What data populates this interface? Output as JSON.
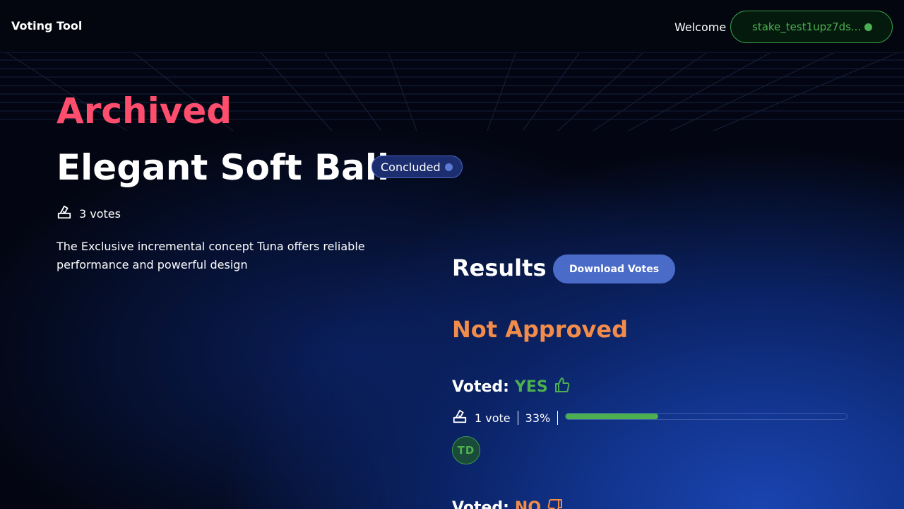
{
  "header": {
    "brand": "Voting Tool",
    "welcome": "Welcome",
    "wallet_address": "stake_test1upz7ds...",
    "wallet_status_color": "#4caf50"
  },
  "proposal": {
    "status_heading": "Archived",
    "title": "Elegant Soft Ball",
    "badge": "Concluded",
    "vote_count": "3 votes",
    "description": "The Exclusive incremental concept Tuna offers reliable performance and powerful design"
  },
  "results": {
    "title": "Results",
    "download_label": "Download Votes",
    "outcome": "Not Approved",
    "yes": {
      "voted_label": "Voted:",
      "choice": "YES",
      "votes": "1 vote",
      "percent_label": "33%",
      "fraction": 0.33,
      "voters": [
        "TD"
      ]
    },
    "no": {
      "voted_label": "Voted:",
      "choice": "NO"
    }
  },
  "colors": {
    "archived": "#ff4d6d",
    "outcome": "#f28c4a",
    "yes": "#4caf50",
    "accent": "#4a6bc8"
  }
}
